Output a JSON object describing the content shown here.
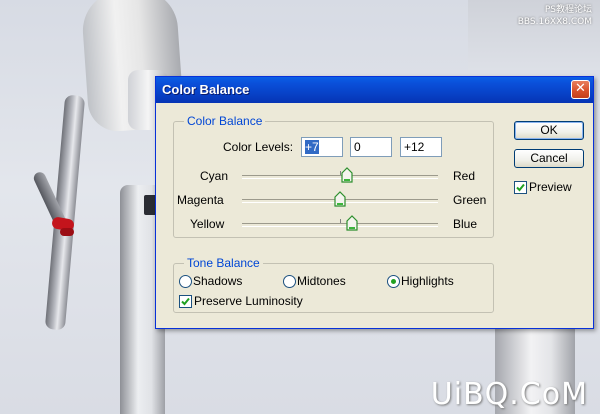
{
  "dialog": {
    "title": "Color Balance",
    "close_glyph": "✕"
  },
  "color_balance": {
    "group_title": "Color Balance",
    "levels_label": "Color Levels:",
    "levels": [
      "+7",
      "0",
      "+12"
    ],
    "sliders": [
      {
        "left": "Cyan",
        "right": "Red",
        "value": 7
      },
      {
        "left": "Magenta",
        "right": "Green",
        "value": 0
      },
      {
        "left": "Yellow",
        "right": "Blue",
        "value": 12
      }
    ]
  },
  "tone_balance": {
    "group_title": "Tone Balance",
    "options": [
      "Shadows",
      "Midtones",
      "Highlights"
    ],
    "selected": "Highlights",
    "preserve_label": "Preserve Luminosity",
    "preserve_checked": true
  },
  "buttons": {
    "ok": "OK",
    "cancel": "Cancel"
  },
  "preview": {
    "label": "Preview",
    "checked": true
  },
  "watermarks": {
    "top_line1": "PS教程论坛",
    "top_line2": "BBS.16XX8.COM",
    "bottom": "UiBQ.CoM"
  },
  "colors": {
    "titlebar": "#0a4fd9",
    "dialog_bg": "#ece9d8",
    "group_title": "#0046d5",
    "selection": "#316ac5",
    "check_green": "#21a121"
  },
  "icons": {
    "close": "close-icon",
    "slider_thumb": "slider-thumb-icon",
    "check": "checkmark-icon"
  }
}
